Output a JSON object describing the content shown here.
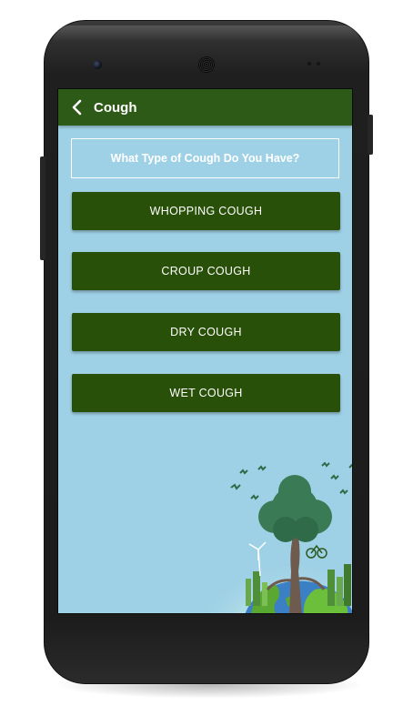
{
  "app_bar": {
    "title": "Cough",
    "back_icon": "chevron-left-icon"
  },
  "question": "What Type of Cough Do You Have?",
  "options": [
    {
      "label": "WHOPPING COUGH"
    },
    {
      "label": "CROUP COUGH"
    },
    {
      "label": "DRY COUGH"
    },
    {
      "label": "WET COUGH"
    }
  ],
  "colors": {
    "app_bar": "#2e5a17",
    "background": "#9fd1e6",
    "button": "#285008",
    "text": "#ffffff"
  }
}
